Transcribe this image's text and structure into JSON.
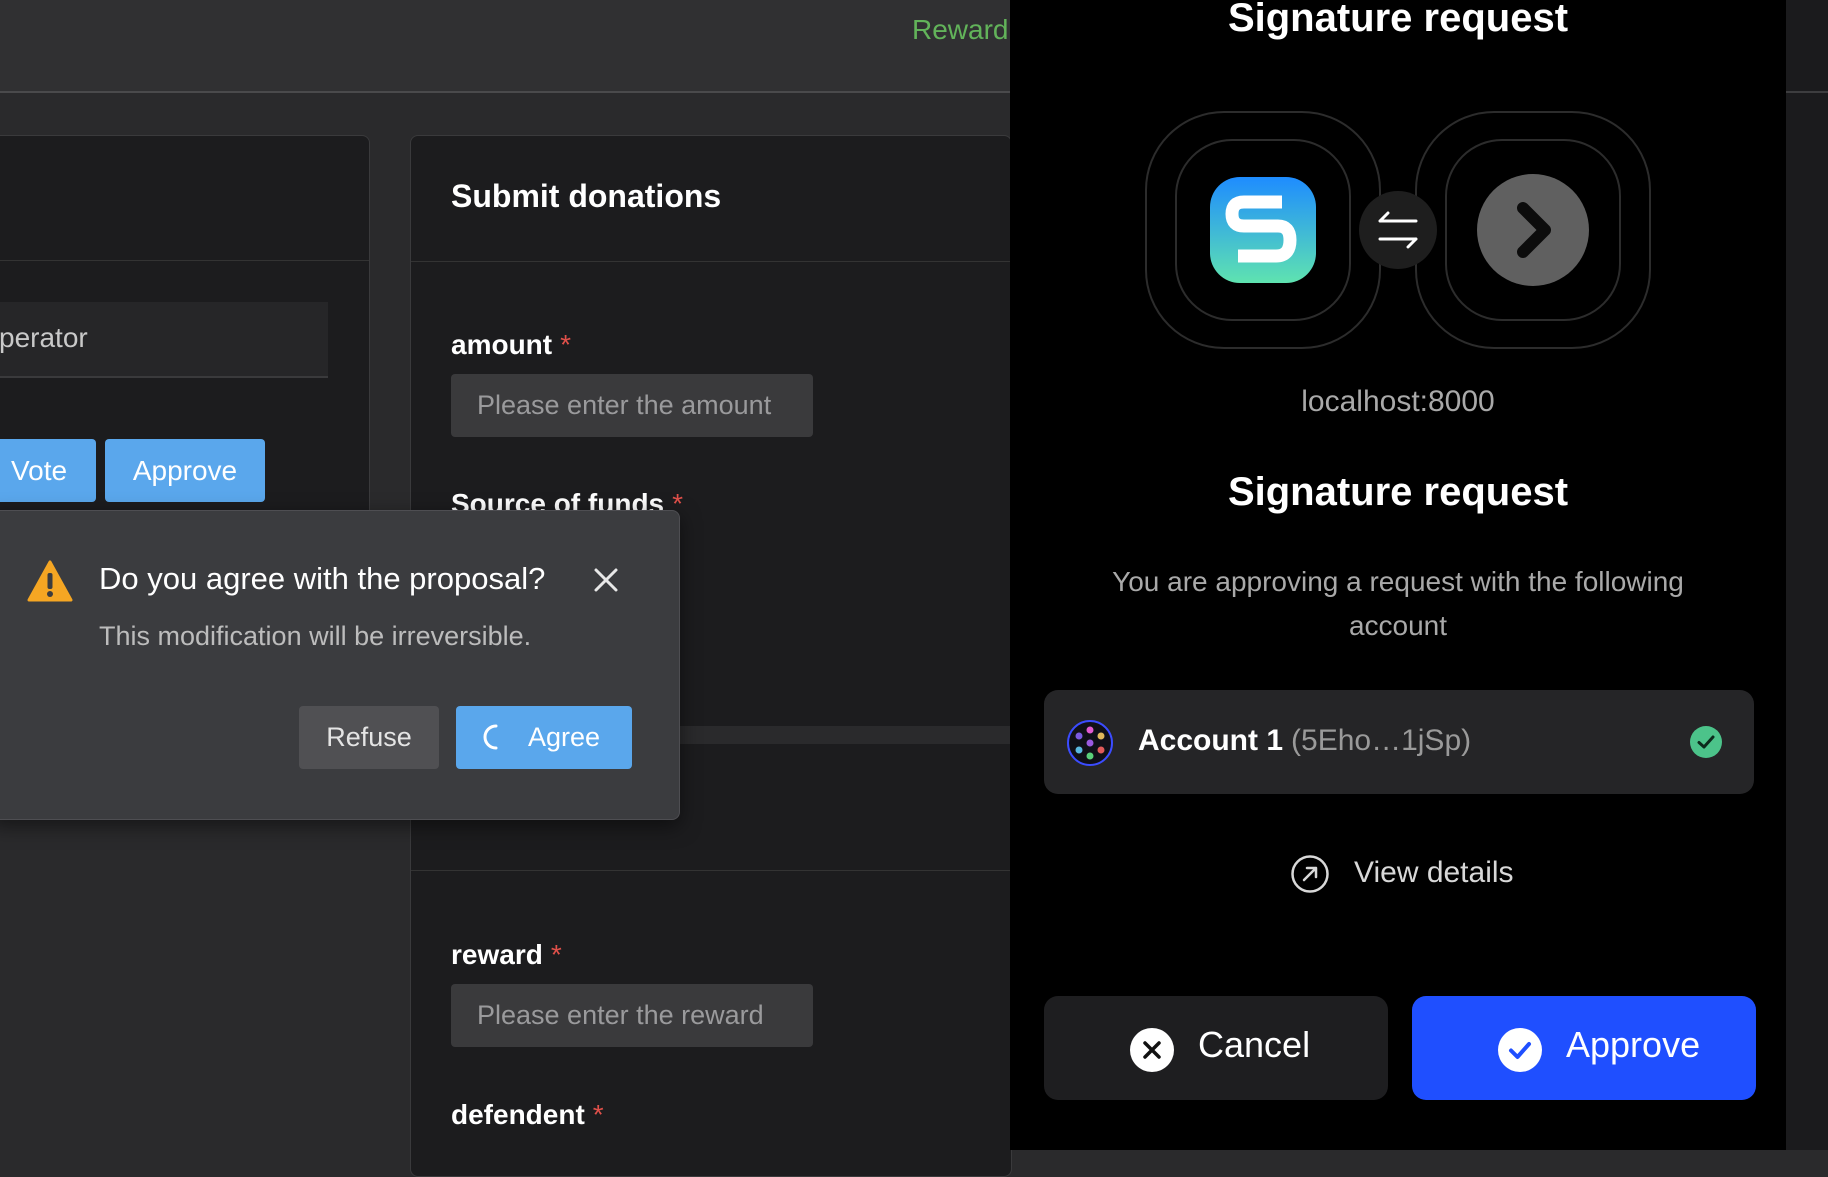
{
  "app": {
    "reward_link": "Reward",
    "left_card": {
      "operator_label": "perator",
      "vote_label": "Vote",
      "approve_label": "Approve"
    },
    "form": {
      "title": "Submit donations",
      "fields": [
        {
          "label": "amount",
          "required_mark": "*",
          "placeholder": "Please enter the amount"
        },
        {
          "label": "Source of funds",
          "required_mark": "*"
        },
        {
          "label": "reward",
          "required_mark": "*",
          "placeholder": "Please enter the reward"
        },
        {
          "label": "defendent",
          "required_mark": "*"
        }
      ]
    }
  },
  "popconfirm": {
    "title": "Do you agree with the proposal?",
    "description": "This modification will be irreversible.",
    "refuse_label": "Refuse",
    "agree_label": "Agree",
    "icon": "warning-icon",
    "agree_loading": true
  },
  "wallet": {
    "title_top": "Signature request",
    "host": "localhost:8000",
    "title": "Signature request",
    "subtitle": "You are approving a request with the following account",
    "account": {
      "name": "Account 1",
      "address": "(5Eho…1jSp)",
      "selected": true
    },
    "view_details_label": "View details",
    "cancel_label": "Cancel",
    "approve_label": "Approve",
    "colors": {
      "approve": "#1f4fff",
      "check": "#4cc38a",
      "warning": "#f5a623"
    }
  }
}
